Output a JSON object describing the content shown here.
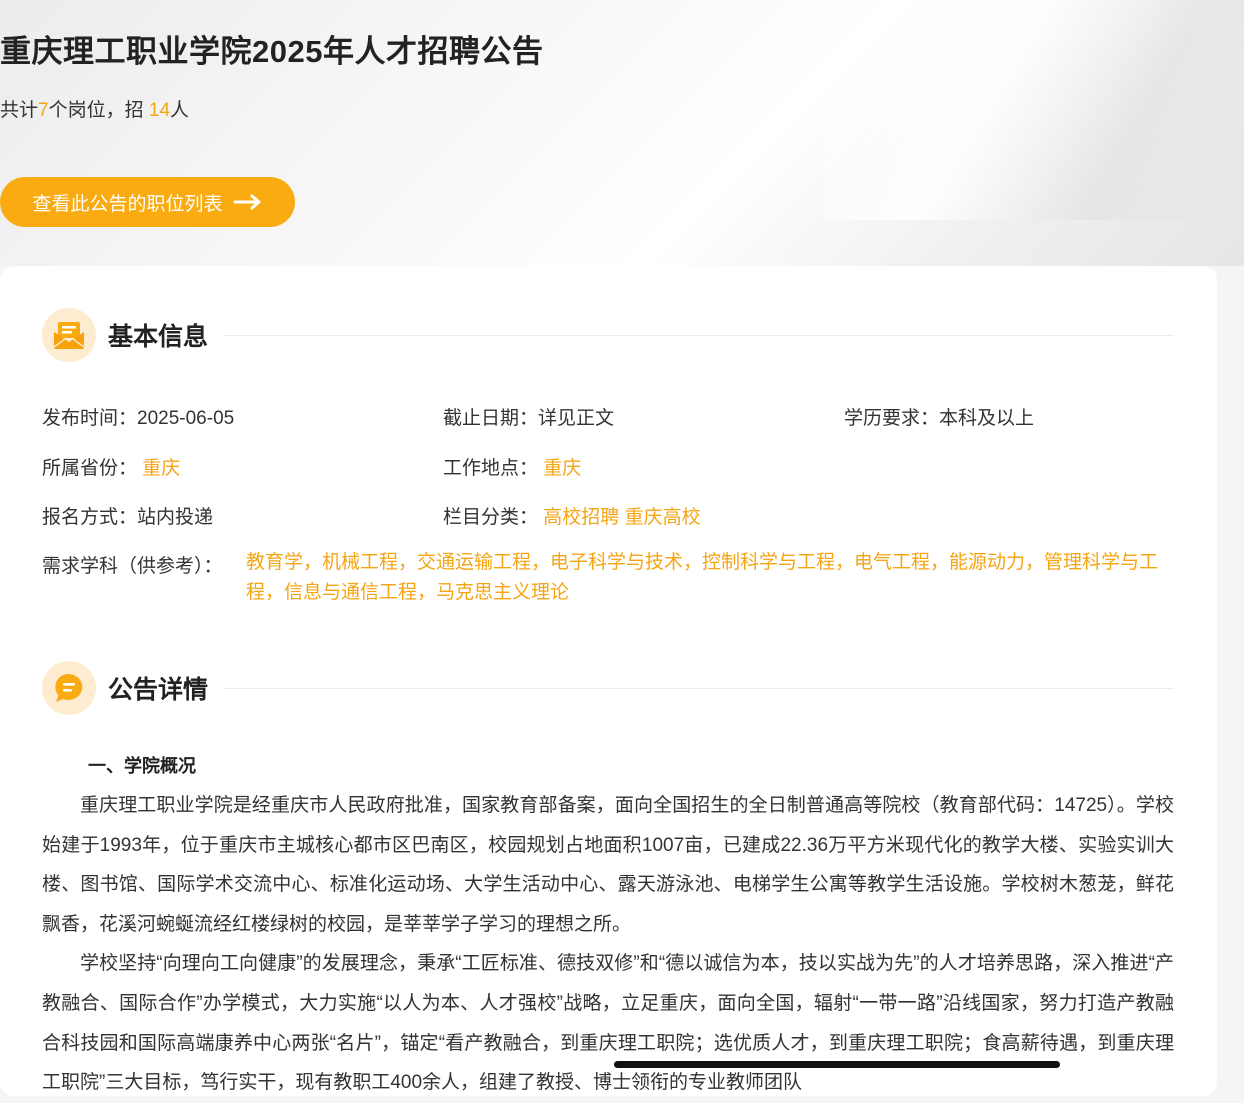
{
  "header": {
    "title": "重庆理工职业学院2025年人才招聘公告",
    "summary_prefix": "共计",
    "positions_count": "7",
    "summary_middle": "个岗位，招 ",
    "hires_count": "14",
    "summary_suffix": "人",
    "view_positions_button": "查看此公告的职位列表"
  },
  "basic_info": {
    "section_title": "基本信息",
    "publish_label": "发布时间：",
    "publish_value": "2025-06-05",
    "deadline_label": "截止日期：",
    "deadline_value": "详见正文",
    "education_label": "学历要求：",
    "education_value": "本科及以上",
    "province_label": "所属省份：",
    "province_value": "重庆",
    "location_label": "工作地点：",
    "location_value": "重庆",
    "apply_label": "报名方式：",
    "apply_value": "站内投递",
    "category_label": "栏目分类：",
    "category_value_1": "高校招聘",
    "category_value_2": "重庆高校",
    "subjects_label": "需求学科（供参考）：",
    "subjects_value": "教育学，机械工程，交通运输工程，电子科学与技术，控制科学与工程，电气工程，能源动力，管理科学与工程，信息与通信工程，马克思主义理论"
  },
  "details": {
    "section_title": "公告详情",
    "heading_1": "一、学院概况",
    "paragraph_1": "重庆理工职业学院是经重庆市人民政府批准，国家教育部备案，面向全国招生的全日制普通高等院校（教育部代码：14725）。学校始建于1993年，位于重庆市主城核心都市区巴南区，校园规划占地面积1007亩，已建成22.36万平方米现代化的教学大楼、实验实训大楼、图书馆、国际学术交流中心、标准化运动场、大学生活动中心、露天游泳池、电梯学生公寓等教学生活设施。学校树木葱茏，鲜花飘香，花溪河蜿蜒流经红楼绿树的校园，是莘莘学子学习的理想之所。",
    "paragraph_2": "学校坚持“向理向工向健康”的发展理念，秉承“工匠标准、德技双修”和“德以诚信为本，技以实战为先”的人才培养思路，深入推进“产教融合、国际合作”办学模式，大力实施“以人为本、人才强校”战略，立足重庆，面向全国，辐射“一带一路”沿线国家，努力打造产教融合科技园和国际高端康养中心两张“名片”，锚定“看产教融合，到重庆理工职院；选优质人才，到重庆理工职院；食高薪待遇，到重庆理工职院”三大目标，笃行实干，现有教职工400余人，组建了教授、博士领衔的专业教师团队"
  }
}
